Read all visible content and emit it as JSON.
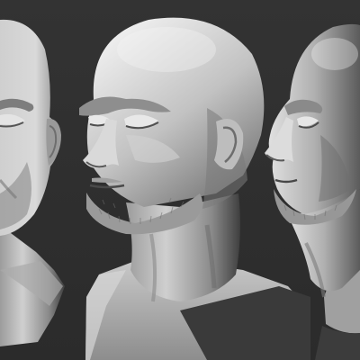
{
  "viewport": {
    "background_color": "#2f2f2f"
  },
  "scene": {
    "material_color": "#b8b8b8",
    "views": [
      {
        "view": "left-partial"
      },
      {
        "view": "three-quarter"
      },
      {
        "view": "profile"
      }
    ]
  }
}
